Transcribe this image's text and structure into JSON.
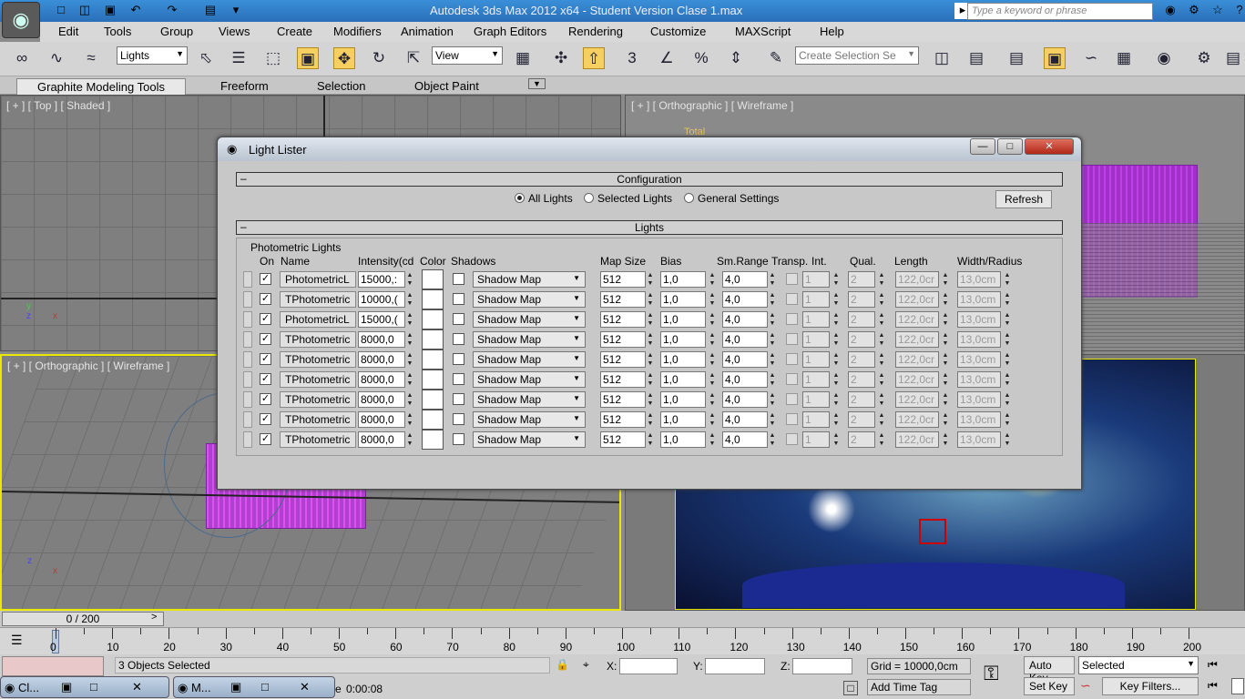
{
  "app": {
    "title": "Autodesk 3ds Max  2012 x64  -  Student Version    Clase 1.max",
    "search_placeholder": "Type a keyword or phrase",
    "app_icon": "3ds-max-logo-icon"
  },
  "menu": [
    "Edit",
    "Tools",
    "Group",
    "Views",
    "Create",
    "Modifiers",
    "Animation",
    "Graph Editors",
    "Rendering",
    "Customize",
    "MAXScript",
    "Help"
  ],
  "toolbar": {
    "selection_filter": "Lights",
    "ref_coord": "View",
    "named_selection": "Create Selection Se",
    "icons": [
      "link-icon",
      "unlink-icon",
      "bind-space-warp-icon",
      "select-object-icon",
      "select-by-name-icon",
      "rect-selection-icon",
      "window-crossing-icon",
      "move-icon",
      "rotate-icon",
      "scale-icon",
      "pivot-icon",
      "select-manipulate-icon",
      "keyboard-shortcut-icon",
      "snap-3d-icon",
      "angle-snap-icon",
      "percent-snap-icon",
      "spinner-snap-icon",
      "edit-named-sets-icon",
      "mirror-icon",
      "align-icon",
      "layer-manager-icon",
      "graphite-toggle-icon",
      "curve-editor-icon",
      "schematic-view-icon",
      "material-editor-icon",
      "render-setup-icon",
      "rendered-frame-icon"
    ],
    "snap_label": "3"
  },
  "ribbon": {
    "tabs": [
      "Graphite Modeling Tools",
      "Freeform",
      "Selection",
      "Object Paint"
    ]
  },
  "viewports": {
    "top_left": "[ + ] [ Top ] [ Shaded ]",
    "top_right": "[ + ] [ Orthographic ] [ Wireframe ]",
    "bottom_left": "[ + ] [ Orthographic ] [ Wireframe ]",
    "total_label": "Total"
  },
  "dialog": {
    "title": "Light Lister",
    "config_header": "Configuration",
    "lights_header": "Lights",
    "collapse": "–",
    "radios": [
      {
        "label": "All Lights",
        "checked": true
      },
      {
        "label": "Selected Lights",
        "checked": false
      },
      {
        "label": "General Settings",
        "checked": false
      }
    ],
    "refresh": "Refresh",
    "group_label": "Photometric Lights",
    "columns": {
      "on": "On",
      "name": "Name",
      "intensity": "Intensity(cd",
      "color": "Color",
      "shadows": "Shadows",
      "map_size": "Map Size",
      "bias": "Bias",
      "sm_range": "Sm.Range",
      "transp": "Transp.",
      "int": "Int.",
      "qual": "Qual.",
      "length": "Length",
      "width": "Width/Radius"
    },
    "rows": [
      {
        "name": "PhotometricL",
        "intensity": "15000,:",
        "shadow": "Shadow Map",
        "map_size": "512",
        "bias": "1,0",
        "sm_range": "4,0",
        "int": "1",
        "qual": "2",
        "length": "122,0cr",
        "width": "13,0cm"
      },
      {
        "name": "TPhotometric",
        "intensity": "10000,(",
        "shadow": "Shadow Map",
        "map_size": "512",
        "bias": "1,0",
        "sm_range": "4,0",
        "int": "1",
        "qual": "2",
        "length": "122,0cr",
        "width": "13,0cm"
      },
      {
        "name": "PhotometricL",
        "intensity": "15000,(",
        "shadow": "Shadow Map",
        "map_size": "512",
        "bias": "1,0",
        "sm_range": "4,0",
        "int": "1",
        "qual": "2",
        "length": "122,0cr",
        "width": "13,0cm"
      },
      {
        "name": "TPhotometric",
        "intensity": "8000,0",
        "shadow": "Shadow Map",
        "map_size": "512",
        "bias": "1,0",
        "sm_range": "4,0",
        "int": "1",
        "qual": "2",
        "length": "122,0cr",
        "width": "13,0cm"
      },
      {
        "name": "TPhotometric",
        "intensity": "8000,0",
        "shadow": "Shadow Map",
        "map_size": "512",
        "bias": "1,0",
        "sm_range": "4,0",
        "int": "1",
        "qual": "2",
        "length": "122,0cr",
        "width": "13,0cm"
      },
      {
        "name": "TPhotometric",
        "intensity": "8000,0",
        "shadow": "Shadow Map",
        "map_size": "512",
        "bias": "1,0",
        "sm_range": "4,0",
        "int": "1",
        "qual": "2",
        "length": "122,0cr",
        "width": "13,0cm"
      },
      {
        "name": "TPhotometric",
        "intensity": "8000,0",
        "shadow": "Shadow Map",
        "map_size": "512",
        "bias": "1,0",
        "sm_range": "4,0",
        "int": "1",
        "qual": "2",
        "length": "122,0cr",
        "width": "13,0cm"
      },
      {
        "name": "TPhotometric",
        "intensity": "8000,0",
        "shadow": "Shadow Map",
        "map_size": "512",
        "bias": "1,0",
        "sm_range": "4,0",
        "int": "1",
        "qual": "2",
        "length": "122,0cr",
        "width": "13,0cm"
      },
      {
        "name": "TPhotometric",
        "intensity": "8000,0",
        "shadow": "Shadow Map",
        "map_size": "512",
        "bias": "1,0",
        "sm_range": "4,0",
        "int": "1",
        "qual": "2",
        "length": "122,0cr",
        "width": "13,0cm"
      }
    ]
  },
  "timeline": {
    "slider": "0 / 200",
    "ticks": [
      "0",
      "10",
      "20",
      "30",
      "40",
      "50",
      "60",
      "70",
      "80",
      "90",
      "100",
      "110",
      "120",
      "130",
      "140",
      "150",
      "160",
      "170",
      "180",
      "190",
      "200"
    ]
  },
  "status": {
    "selected": "3 Objects Selected",
    "x_label": "X:",
    "y_label": "Y:",
    "z_label": "Z:",
    "grid": "Grid = 10000,0cm",
    "auto_key": "Auto Key",
    "set_key": "Set Key",
    "key_mode": "Selected",
    "key_filters": "Key Filters...",
    "add_time_tag": "Add Time Tag",
    "time": "0:00:08",
    "time_prefix": "e"
  },
  "taskbar": [
    "Cl...",
    "M..."
  ],
  "colors": {
    "accent": "#f5d060",
    "title": "#2a6fb8",
    "viewport_active": "#e8e800"
  }
}
